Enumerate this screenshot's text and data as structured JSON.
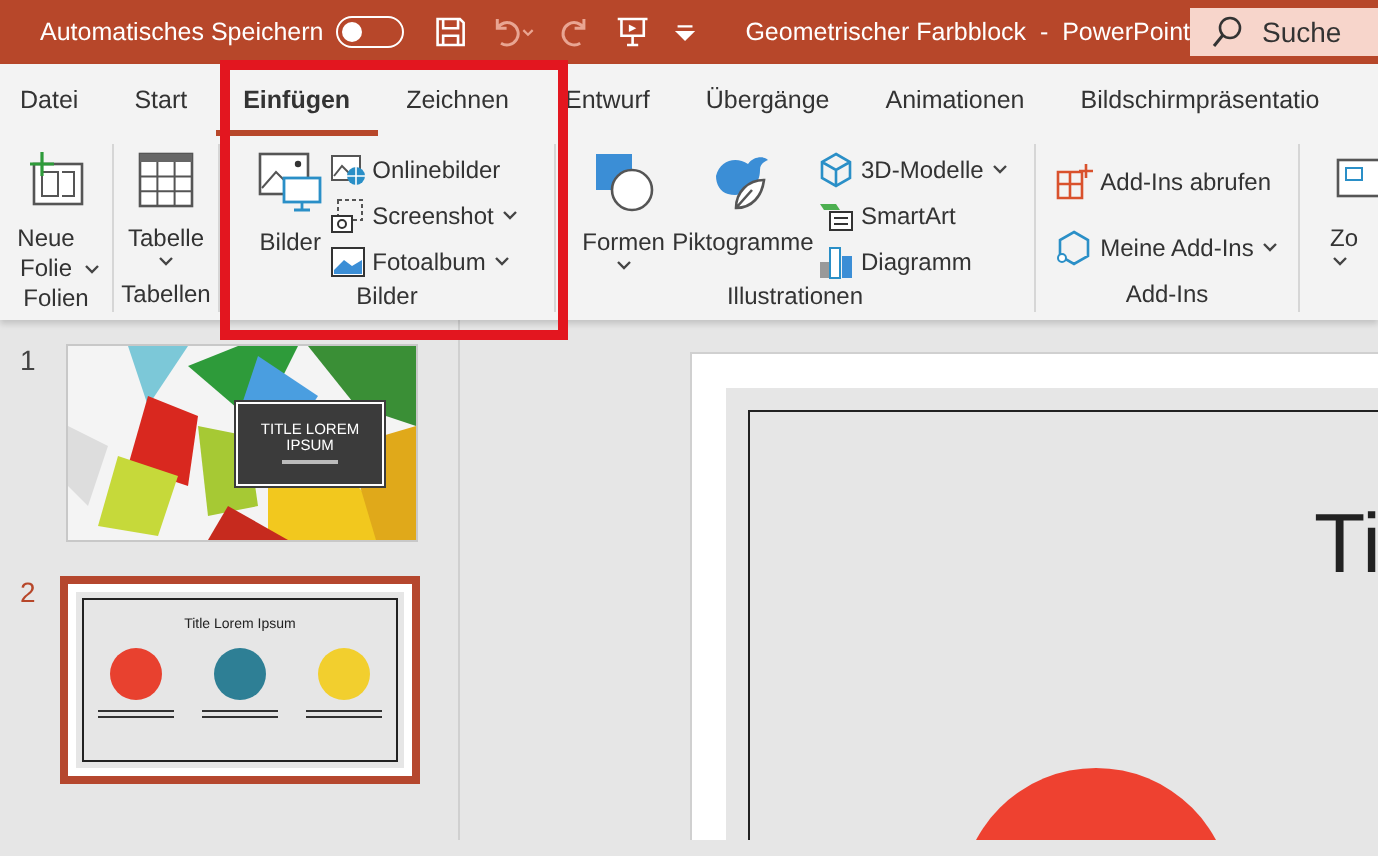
{
  "title_bar": {
    "autosave_label": "Automatisches Speichern",
    "autosave_on": false,
    "title": "Geometrischer Farbblock  -  PowerPoint",
    "search": {
      "placeholder": "Suche"
    }
  },
  "tabs": [
    {
      "label": "Datei",
      "selected": false
    },
    {
      "label": "Start",
      "selected": false
    },
    {
      "label": "Einfügen",
      "selected": true
    },
    {
      "label": "Zeichnen",
      "selected": false
    },
    {
      "label": "Entwurf",
      "selected": false
    },
    {
      "label": "Übergänge",
      "selected": false
    },
    {
      "label": "Animationen",
      "selected": false
    },
    {
      "label": "Bildschirmpräsentatio",
      "selected": false
    }
  ],
  "ribbon": {
    "groups": [
      {
        "label": "Folien",
        "cells": [
          {
            "kind": "large",
            "label": "Neue Folie",
            "dropdown": true
          }
        ]
      },
      {
        "label": "Tabellen",
        "cells": [
          {
            "kind": "large",
            "label": "Tabelle",
            "dropdown": true
          }
        ]
      },
      {
        "label": "Bilder",
        "cells": [
          {
            "kind": "large",
            "label": "Bilder",
            "dropdown": false
          },
          {
            "kind": "stack",
            "items": [
              {
                "label": "Onlinebilder",
                "dropdown": false
              },
              {
                "label": "Screenshot",
                "dropdown": true
              },
              {
                "label": "Fotoalbum",
                "dropdown": true
              }
            ]
          }
        ]
      },
      {
        "label": "Illustrationen",
        "cells": [
          {
            "kind": "large",
            "label": "Formen",
            "dropdown": true
          },
          {
            "kind": "large",
            "label": "Piktogramme",
            "dropdown": false
          },
          {
            "kind": "stack",
            "items": [
              {
                "label": "3D-Modelle",
                "dropdown": true
              },
              {
                "label": "SmartArt",
                "dropdown": false
              },
              {
                "label": "Diagramm",
                "dropdown": false
              }
            ]
          }
        ]
      },
      {
        "label": "Add-Ins",
        "cells": [
          {
            "kind": "stack",
            "items": [
              {
                "label": "Add-Ins abrufen",
                "dropdown": false
              },
              {
                "label": "Meine Add-Ins",
                "dropdown": true
              }
            ]
          }
        ]
      },
      {
        "cells": [
          {
            "kind": "large",
            "label": "Zo",
            "dropdown": true
          }
        ]
      }
    ]
  },
  "slides": [
    {
      "number": "1",
      "selected": false,
      "kind": "title",
      "title": "TITLE LOREM IPSUM"
    },
    {
      "number": "2",
      "selected": true,
      "kind": "content",
      "title": "Title Lorem Ipsum",
      "icons": [
        {
          "color": "#e8412f"
        },
        {
          "color": "#2e7f95"
        },
        {
          "color": "#f2cf2e"
        }
      ]
    }
  ],
  "main_slide": {
    "title": "Ti"
  }
}
